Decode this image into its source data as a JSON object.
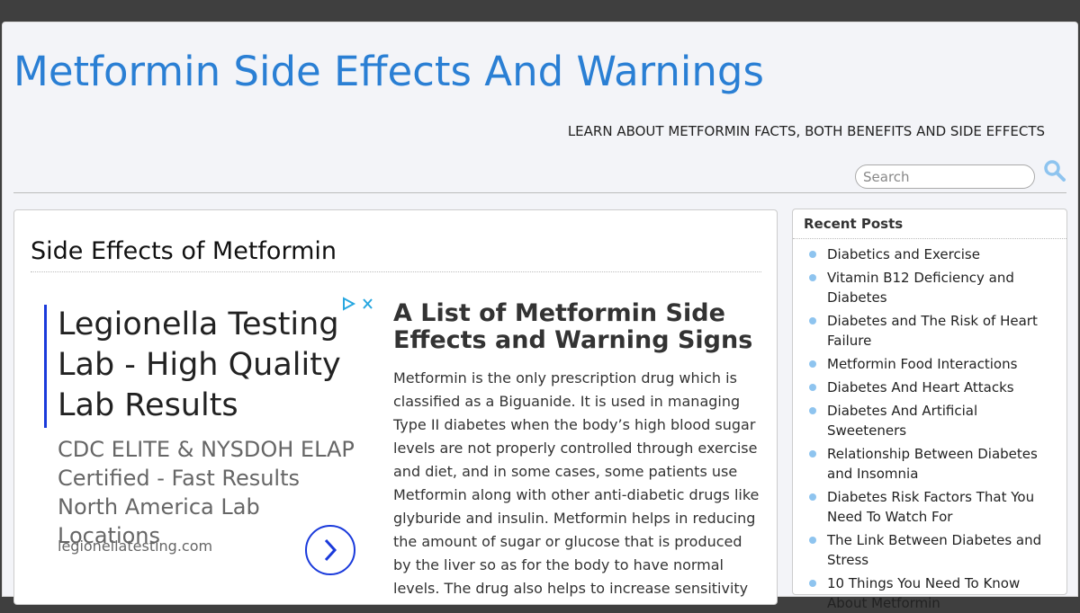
{
  "header": {
    "site_title": "Metformin Side Effects And Warnings",
    "tagline": "LEARN ABOUT METFORMIN FACTS, BOTH BENEFITS AND SIDE EFFECTS",
    "search_placeholder": "Search"
  },
  "post": {
    "title": "Side Effects of Metformin"
  },
  "ad": {
    "headline": "Legionella Testing Lab - High Quality Lab Results",
    "description": "CDC ELITE & NYSDOH ELAP Certified - Fast Results North America Lab Locations",
    "domain": "legionellatesting.com"
  },
  "article": {
    "heading": "A List of Metformin Side Effects and Warning Signs",
    "body": "Metformin is the only prescription drug which is classified as a Biguanide. It is used in managing Type II diabetes when the body’s high blood sugar levels are not properly controlled through exercise and diet, and in some cases, some patients use Metformin along with other anti-diabetic drugs like glyburide and insulin. Metformin helps in reducing the amount of sugar or glucose that is produced by the liver so as for the body to have normal levels. The drug also helps to increase sensitivity"
  },
  "sidebar": {
    "title": "Recent Posts",
    "items": [
      {
        "label": "Diabetics and Exercise"
      },
      {
        "label": "Vitamin B12 Deficiency and Diabetes"
      },
      {
        "label": "Diabetes and The Risk of Heart Failure"
      },
      {
        "label": "Metformin Food Interactions"
      },
      {
        "label": "Diabetes And Heart Attacks"
      },
      {
        "label": "Diabetes And Artificial Sweeteners"
      },
      {
        "label": "Relationship Between Diabetes and Insomnia"
      },
      {
        "label": "Diabetes Risk Factors That You Need To Watch For"
      },
      {
        "label": "The Link Between Diabetes and Stress"
      },
      {
        "label": "10 Things You Need To Know About Metformin"
      }
    ]
  },
  "colors": {
    "title_blue": "#2a7fd4",
    "ad_blue": "#1a3adb",
    "bullet": "#8ec4ef",
    "search_icon": "#8ec4ef"
  }
}
